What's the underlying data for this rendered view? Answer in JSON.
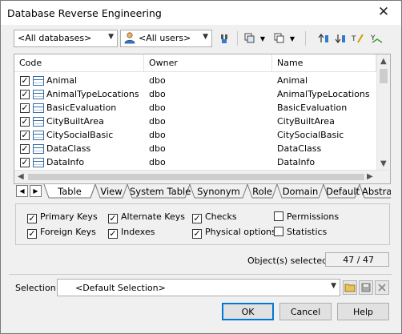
{
  "window": {
    "title": "Database Reverse Engineering",
    "close_glyph": "✕"
  },
  "toolbar": {
    "database_filter": "<All databases>",
    "user_filter": "<All users>",
    "icons": [
      "find-icon",
      "select-all-icon",
      "deselect-all-icon",
      "move-up-icon",
      "move-down-icon",
      "filter-icon",
      "sort-icon"
    ]
  },
  "list": {
    "columns": [
      "Code",
      "Owner",
      "Name"
    ],
    "rows": [
      {
        "code": "Animal",
        "owner": "dbo",
        "name": "Animal",
        "checked": true
      },
      {
        "code": "AnimalTypeLocations",
        "owner": "dbo",
        "name": "AnimalTypeLocations",
        "checked": true
      },
      {
        "code": "BasicEvaluation",
        "owner": "dbo",
        "name": "BasicEvaluation",
        "checked": true
      },
      {
        "code": "CityBuiltArea",
        "owner": "dbo",
        "name": "CityBuiltArea",
        "checked": true
      },
      {
        "code": "CitySocialBasic",
        "owner": "dbo",
        "name": "CitySocialBasic",
        "checked": true
      },
      {
        "code": "DataClass",
        "owner": "dbo",
        "name": "DataClass",
        "checked": true
      },
      {
        "code": "DataInfo",
        "owner": "dbo",
        "name": "DataInfo",
        "checked": true
      }
    ]
  },
  "tabs": [
    "Table",
    "View",
    "System Table",
    "Synonym",
    "Role",
    "Domain",
    "Default",
    "Abstra"
  ],
  "options": {
    "primary_keys": {
      "label": "Primary Keys",
      "checked": true
    },
    "foreign_keys": {
      "label": "Foreign Keys",
      "checked": true
    },
    "alternate_keys": {
      "label": "Alternate Keys",
      "checked": true
    },
    "indexes": {
      "label": "Indexes",
      "checked": true
    },
    "checks": {
      "label": "Checks",
      "checked": true
    },
    "physical_options": {
      "label": "Physical options",
      "checked": true
    },
    "permissions": {
      "label": "Permissions",
      "checked": false
    },
    "statistics": {
      "label": "Statistics",
      "checked": false
    }
  },
  "status": {
    "label": "Object(s) selected:",
    "value": "47 / 47"
  },
  "selection": {
    "label": "Selection:",
    "value": "<Default Selection>"
  },
  "buttons": {
    "ok": "OK",
    "cancel": "Cancel",
    "help": "Help"
  }
}
